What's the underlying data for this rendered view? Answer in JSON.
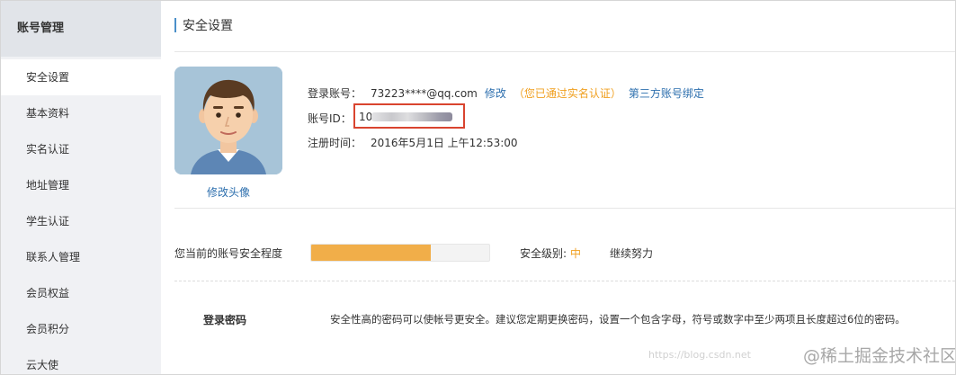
{
  "sidebar": {
    "title": "账号管理",
    "items": [
      {
        "label": "安全设置"
      },
      {
        "label": "基本资料"
      },
      {
        "label": "实名认证"
      },
      {
        "label": "地址管理"
      },
      {
        "label": "学生认证"
      },
      {
        "label": "联系人管理"
      },
      {
        "label": "会员权益"
      },
      {
        "label": "会员积分"
      },
      {
        "label": "云大使"
      }
    ]
  },
  "page": {
    "title": "安全设置"
  },
  "profile": {
    "change_avatar": "修改头像",
    "login_account_label": "登录账号：",
    "login_account_value": "73223****@qq.com",
    "modify_link": "修改",
    "verified_text": "（您已通过实名认证）",
    "third_party_link": "第三方账号绑定",
    "account_id_label": "账号ID：",
    "account_id_prefix": "10",
    "register_time_label": "注册时间：",
    "register_time_value": "2016年5月1日 上午12:53:00"
  },
  "security": {
    "label": "您当前的账号安全程度",
    "progress_fraction": 0.67,
    "level_label": "安全级别:",
    "level_value": "中",
    "hint": "继续努力"
  },
  "password": {
    "title": "登录密码",
    "description": "安全性高的密码可以使帐号更安全。建议您定期更换密码，设置一个包含字母，符号或数字中至少两项且长度超过6位的密码。"
  },
  "watermark": {
    "url": "https://blog.csdn.net",
    "brand": "@稀土掘金技术社区"
  },
  "colors": {
    "accent_blue": "#2d6fae",
    "orange": "#f0a020",
    "progress_fill": "#f1ae49",
    "highlight_red": "#d9442f"
  }
}
